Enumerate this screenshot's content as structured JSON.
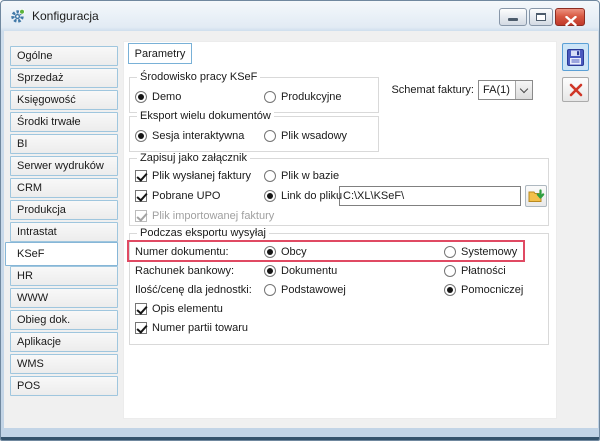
{
  "window": {
    "title": "Konfiguracja",
    "controls": {
      "minimize": "minimize-button",
      "maximize": "maximize-button",
      "close": "close-button"
    }
  },
  "icons": {
    "titlebar": "gear-icon",
    "save": "floppy-disk-icon",
    "cancel": "red-x-icon",
    "browse": "folder-green-arrow-icon",
    "dropdown": "chevron-down-icon"
  },
  "colors": {
    "highlight_red": "#e04a63",
    "close_button_red": "#c0392a",
    "frame_blue": "#c2d4e6",
    "sidebar_border_blue": "#9fc6de",
    "save_button_accent": "#5ba0d6",
    "save_icon_blue": "#4a5abf",
    "folder_yellow": "#f3c04a",
    "arrow_green": "#2f9e3f"
  },
  "sidebar": {
    "items": [
      {
        "label": "Ogólne",
        "active": false
      },
      {
        "label": "Sprzedaż",
        "active": false
      },
      {
        "label": "Księgowość",
        "active": false
      },
      {
        "label": "Środki trwałe",
        "active": false
      },
      {
        "label": "BI",
        "active": false
      },
      {
        "label": "Serwer wydruków",
        "active": false
      },
      {
        "label": "CRM",
        "active": false
      },
      {
        "label": "Produkcja",
        "active": false
      },
      {
        "label": "Intrastat",
        "active": false
      },
      {
        "label": "KSeF",
        "active": true
      },
      {
        "label": "HR",
        "active": false
      },
      {
        "label": "WWW",
        "active": false
      },
      {
        "label": "Obieg dok.",
        "active": false
      },
      {
        "label": "Aplikacje",
        "active": false
      },
      {
        "label": "WMS",
        "active": false
      },
      {
        "label": "POS",
        "active": false
      }
    ]
  },
  "main": {
    "tab_label": "Parametry",
    "schema": {
      "label": "Schemat faktury:",
      "value": "FA(1)"
    },
    "groups": {
      "env": {
        "title": "Środowisko pracy KSeF",
        "options": [
          {
            "label": "Demo",
            "selected": true
          },
          {
            "label": "Produkcyjne",
            "selected": false
          }
        ]
      },
      "export": {
        "title": "Eksport wielu dokumentów",
        "options": [
          {
            "label": "Sesja interaktywna",
            "selected": true
          },
          {
            "label": "Plik wsadowy",
            "selected": false
          }
        ]
      },
      "attach": {
        "title": "Zapisuj jako załącznik",
        "checkboxes": [
          {
            "label": "Plik wysłanej faktury",
            "checked": true,
            "disabled": false
          },
          {
            "label": "Pobrane UPO",
            "checked": true,
            "disabled": false
          },
          {
            "label": "Plik importowanej faktury",
            "checked": true,
            "disabled": true
          }
        ],
        "radios": [
          {
            "label": "Plik w bazie",
            "selected": false
          },
          {
            "label": "Link do pliku",
            "selected": true
          }
        ],
        "path_value": "C:\\XL\\KSeF\\"
      },
      "send": {
        "title": "Podczas eksportu wysyłaj",
        "rows": [
          {
            "label": "Numer dokumentu:",
            "opt1": "Obcy",
            "opt1_selected": true,
            "opt2": "Systemowy",
            "opt2_selected": false,
            "highlighted": true
          },
          {
            "label": "Rachunek bankowy:",
            "opt1": "Dokumentu",
            "opt1_selected": true,
            "opt2": "Płatności",
            "opt2_selected": false,
            "highlighted": false
          },
          {
            "label": "Ilość/cenę dla jednostki:",
            "opt1": "Podstawowej",
            "opt1_selected": false,
            "opt2": "Pomocniczej",
            "opt2_selected": true,
            "highlighted": false
          }
        ],
        "checkboxes": [
          {
            "label": "Opis elementu",
            "checked": true,
            "disabled": false
          },
          {
            "label": "Numer partii towaru",
            "checked": true,
            "disabled": false
          }
        ]
      }
    }
  }
}
